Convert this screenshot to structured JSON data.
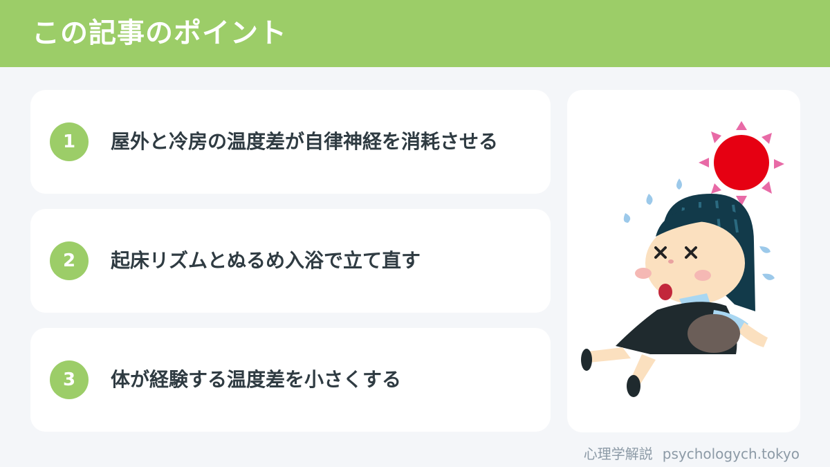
{
  "header": {
    "title": "この記事のポイント"
  },
  "points": [
    {
      "number": "1",
      "text": "屋外と冷房の温度差が自律神経を消耗させる"
    },
    {
      "number": "2",
      "text": "起床リズムとぬるめ入浴で立て直す"
    },
    {
      "number": "3",
      "text": "体が経験する温度差を小さくする"
    }
  ],
  "illustration": {
    "subject": "woman-collapsed-from-heat-with-sun"
  },
  "footer": {
    "site_name": "心理学解説",
    "domain": "psychologych.tokyo"
  },
  "colors": {
    "accent_green": "#9ccd68",
    "background": "#f4f6f9",
    "card": "#ffffff",
    "text_dark": "#2f3b42",
    "footer_text": "#8c9aa6",
    "sun_red": "#e60012"
  }
}
